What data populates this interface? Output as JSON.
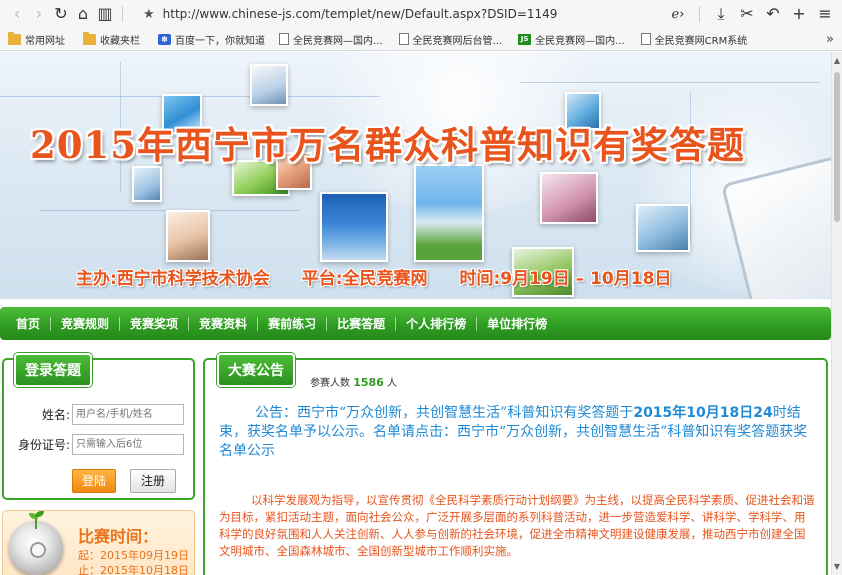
{
  "browser": {
    "url": "http://www.chinese-js.com/templet/new/Default.aspx?DSID=1149",
    "bookmarks": [
      {
        "label": "常用网址",
        "icon": "folder-icon"
      },
      {
        "label": "收藏夹栏",
        "icon": "folder-icon"
      },
      {
        "label": "百度一下，你就知道",
        "icon": "baidu-paw-icon"
      },
      {
        "label": "全民竞赛网—国内...",
        "icon": "document-icon"
      },
      {
        "label": "全民竞赛网后台管...",
        "icon": "document-icon"
      },
      {
        "label": "全民竞赛网—国内...",
        "icon": "js-logo-icon"
      },
      {
        "label": "全民竞赛网CRM系统",
        "icon": "document-icon"
      }
    ]
  },
  "banner": {
    "title": "2015年西宁市万名群众科普知识有奖答题",
    "organizer": "主办:西宁市科学技术协会",
    "platform": "平台:全民竞赛网",
    "period": "时间:9月19日  –  10月18日"
  },
  "nav": {
    "items": [
      "首页",
      "竞赛规则",
      "竞赛奖项",
      "竞赛资料",
      "赛前练习",
      "比赛答题",
      "个人排行榜",
      "单位排行榜"
    ]
  },
  "login": {
    "tab_label": "登录答题",
    "name_label": "姓名:",
    "name_placeholder": "用户名/手机/姓名",
    "id_label": "身份证号:",
    "id_placeholder": "只需输入后6位",
    "login_button": "登陆",
    "register_button": "注册"
  },
  "time": {
    "title": "比赛时间：",
    "start": "起：2015年09月19日",
    "end": "止：2015年10月18日"
  },
  "notice": {
    "tab_label": "大赛公告",
    "participants_label": "参赛人数",
    "participants_count": "1586",
    "participants_unit": "人",
    "announce_before": "公告：西宁市“万众创新，共创智慧生活”科普知识有奖答题于",
    "announce_date": "2015年10月18日24",
    "announce_after": "时结束，获奖名单予以公示。名单请点击：西宁市“万众创新，共创智慧生活”科普知识有奖答题获奖名单公示",
    "description": "以科学发展观为指导，以宣传贯彻《全民科学素质行动计划纲要》为主线，以提高全民科学素质、促进社会和谐为目标，紧扣活动主题，面向社会公众，广泛开展多层面的系列科普活动，进一步营造爱科学、讲科学、学科学、用科学的良好氛围和人人关注创新、人人参与创新的社会环境，促进全市精神文明建设健康发展，推动西宁市创建全国文明城市、全国森林城市、全国创新型城市工作顺利实施。"
  },
  "colors": {
    "nav_green": "#2f9c22",
    "title_orange": "#e8541c",
    "announce_blue": "#1f8ad6",
    "login_orange": "#f08a10"
  }
}
